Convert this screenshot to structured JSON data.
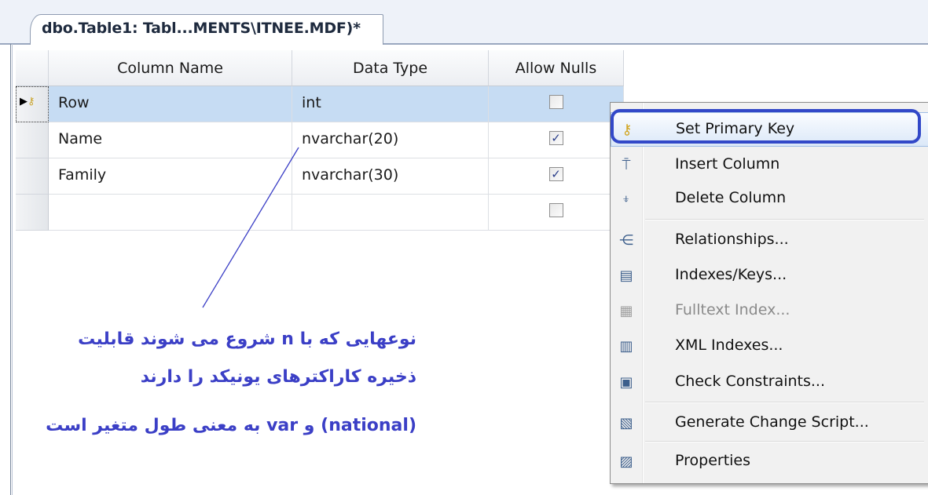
{
  "tab": {
    "title": "dbo.Table1: Tabl...MENTS\\ITNEE.MDF)*"
  },
  "grid": {
    "headers": {
      "column_name": "Column Name",
      "data_type": "Data Type",
      "allow_nulls": "Allow Nulls"
    },
    "rows": [
      {
        "name": "Row",
        "type": "int",
        "allow_nulls": false,
        "primary_key": true,
        "selected": true
      },
      {
        "name": "Name",
        "type": "nvarchar(20)",
        "allow_nulls": true
      },
      {
        "name": "Family",
        "type": "nvarchar(30)",
        "allow_nulls": true
      },
      {
        "name": "",
        "type": "",
        "allow_nulls": false
      }
    ]
  },
  "annotation": {
    "line1": "نوعهایی که با n شروع می شوند قابلیت",
    "line2": "ذخیره کاراکترهای یونیکد را دارند",
    "line3": "(national) و var به معنی طول متغیر است",
    "color": "#3b3fc6"
  },
  "context_menu": {
    "items": [
      {
        "label": "Set Primary Key",
        "icon": "key-icon",
        "highlighted": true
      },
      {
        "label": "Insert Column",
        "icon": "insert-column-icon"
      },
      {
        "label": "Delete Column",
        "icon": "delete-column-icon"
      },
      {
        "label": "Relationships...",
        "icon": "relationships-icon"
      },
      {
        "label": "Indexes/Keys...",
        "icon": "indexes-keys-icon"
      },
      {
        "label": "Fulltext Index...",
        "icon": "fulltext-index-icon",
        "disabled": true
      },
      {
        "label": "XML Indexes...",
        "icon": "xml-indexes-icon"
      },
      {
        "label": "Check Constraints...",
        "icon": "check-constraints-icon"
      },
      {
        "label": "Generate Change Script...",
        "icon": "generate-script-icon"
      },
      {
        "label": "Properties",
        "icon": "properties-icon"
      }
    ]
  }
}
